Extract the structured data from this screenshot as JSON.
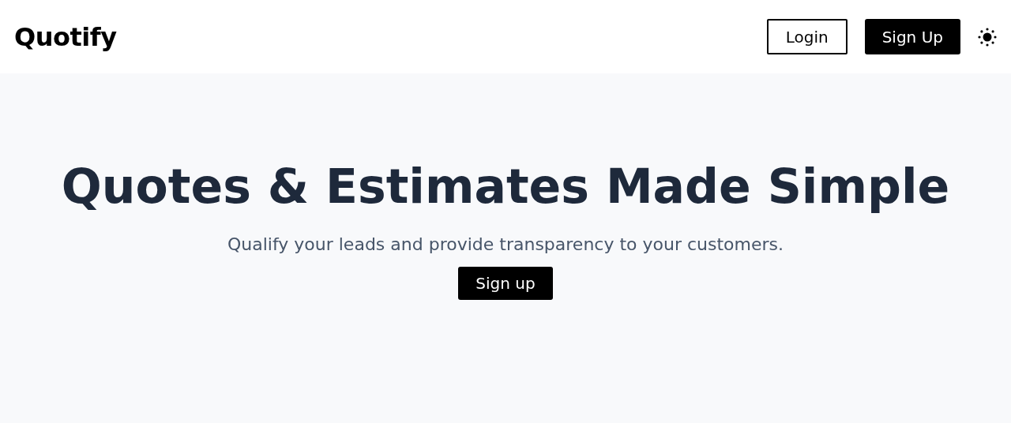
{
  "header": {
    "logo": "Quotify",
    "login": "Login",
    "signup": "Sign Up",
    "theme_toggle": {
      "kind": "sun"
    }
  },
  "hero": {
    "title": "Quotes & Estimates Made Simple",
    "subtitle": "Qualify your leads and provide transparency to your customers.",
    "cta": "Sign up"
  }
}
